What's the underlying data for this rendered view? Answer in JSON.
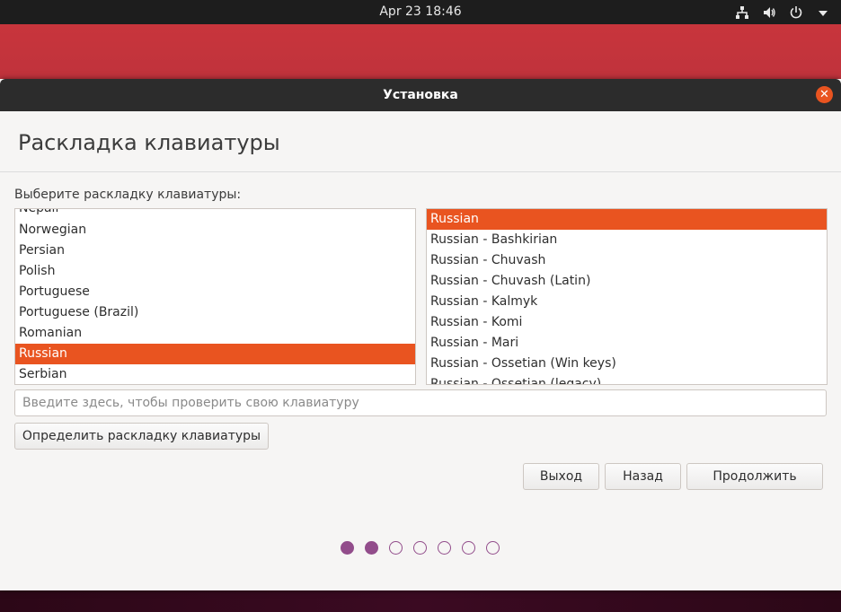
{
  "system_bar": {
    "clock": "Apr 23  18:46",
    "icons": [
      "network-icon",
      "volume-icon",
      "power-icon",
      "chevron-down-icon"
    ]
  },
  "window": {
    "title": "Установка",
    "close_icon": "close-icon"
  },
  "page": {
    "title": "Раскладка клавиатуры",
    "prompt": "Выберите раскладку клавиатуры:"
  },
  "layouts_left": {
    "items": [
      "Nepali",
      "Norwegian",
      "Persian",
      "Polish",
      "Portuguese",
      "Portuguese (Brazil)",
      "Romanian",
      "Russian",
      "Serbian"
    ],
    "selected": "Russian"
  },
  "layouts_right": {
    "items": [
      "Russian",
      "Russian - Bashkirian",
      "Russian - Chuvash",
      "Russian - Chuvash (Latin)",
      "Russian - Kalmyk",
      "Russian - Komi",
      "Russian - Mari",
      "Russian - Ossetian (Win keys)",
      "Russian - Ossetian (legacy)"
    ],
    "selected": "Russian"
  },
  "test_input": {
    "placeholder": "Введите здесь, чтобы проверить свою клавиатуру",
    "value": ""
  },
  "buttons": {
    "detect": "Определить раскладку клавиатуры",
    "quit": "Выход",
    "back": "Назад",
    "continue": "Продолжить"
  },
  "progress": {
    "total_steps": 7,
    "completed_steps": 2
  },
  "colors": {
    "accent": "#e95420",
    "progress": "#924d8b"
  }
}
